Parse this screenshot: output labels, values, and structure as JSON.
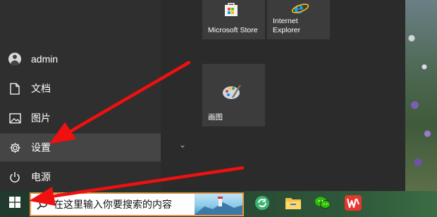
{
  "user": {
    "name": "admin",
    "icon": "user-avatar-icon"
  },
  "rail_items": [
    {
      "label": "文档",
      "icon": "document-icon"
    },
    {
      "label": "图片",
      "icon": "picture-icon"
    },
    {
      "label": "设置",
      "icon": "gear-icon"
    },
    {
      "label": "电源",
      "icon": "power-icon"
    }
  ],
  "tiles": {
    "store": {
      "label": "Microsoft Store",
      "icon": "store-bag-icon"
    },
    "ie": {
      "label_line1": "Internet",
      "label_line2": "Explorer",
      "icon": "internet-explorer-icon"
    },
    "paint": {
      "label": "画图",
      "icon": "paint-palette-icon"
    }
  },
  "taskbar": {
    "search_placeholder": "在这里输入你要搜索的内容",
    "apps": [
      "green-refresh-icon",
      "file-explorer-icon",
      "wechat-icon",
      "wps-office-icon"
    ]
  },
  "colors": {
    "annotation_arrow": "#f01010",
    "search_border": "#e8964a",
    "selected_item": "#454545"
  }
}
